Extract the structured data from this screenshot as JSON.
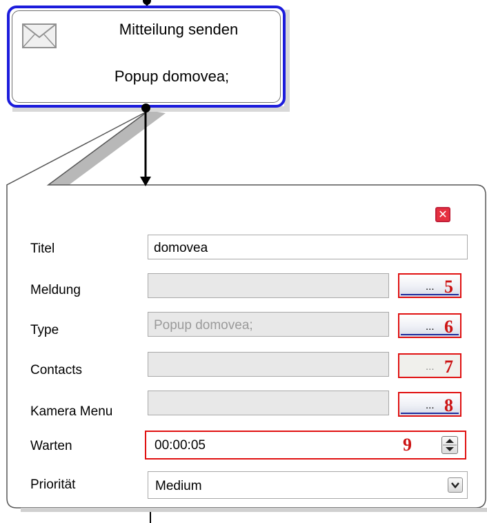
{
  "node": {
    "title": "Mitteilung senden",
    "subtitle": "Popup domovea;",
    "icon": "envelope-icon"
  },
  "panel": {
    "close_icon": "close-icon",
    "rows": {
      "titel": {
        "label": "Titel",
        "value": "domovea"
      },
      "meldung": {
        "label": "Meldung",
        "value": "",
        "button": "...",
        "marker": "5"
      },
      "type": {
        "label": "Type",
        "value": "Popup domovea;",
        "button": "...",
        "marker": "6"
      },
      "contacts": {
        "label": "Contacts",
        "value": "",
        "button": "...",
        "marker": "7"
      },
      "kamera": {
        "label": "Kamera Menu",
        "value": "",
        "button": "...",
        "marker": "8"
      },
      "warten": {
        "label": "Warten",
        "value": "00:00:05",
        "marker": "9"
      },
      "prioritaet": {
        "label": "Priorität",
        "value": "Medium"
      }
    }
  },
  "colors": {
    "node_border": "#1c1cdc",
    "highlight": "#e01010",
    "close": "#e63040"
  }
}
